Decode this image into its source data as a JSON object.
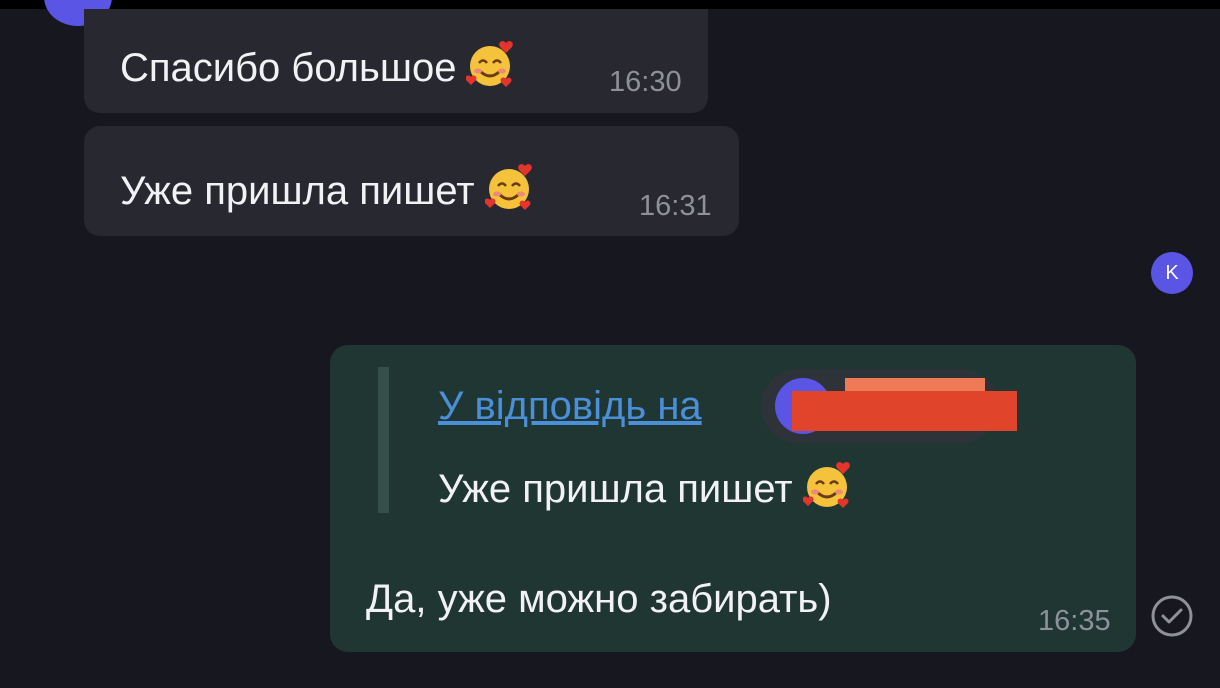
{
  "messages": [
    {
      "text": "Спасибо большое",
      "emoji": "smiling-face-with-hearts",
      "time": "16:30"
    },
    {
      "text": "Уже пришла пишет",
      "emoji": "smiling-face-with-hearts",
      "time": "16:31"
    }
  ],
  "sender_badge": "K",
  "reply": {
    "link_label": "У відповідь на",
    "quoted_text": "Уже пришла пишет",
    "quoted_emoji": "smiling-face-with-hearts",
    "text": "Да, уже можно забирать)",
    "time": "16:35",
    "status_icon": "check-circle-icon"
  },
  "colors": {
    "background": "#17181f",
    "incoming_bubble": "#272830",
    "outgoing_bubble": "#1f3633",
    "link": "#4a8fd8",
    "avatar": "#5b55e6",
    "redaction": "#e0452b"
  }
}
